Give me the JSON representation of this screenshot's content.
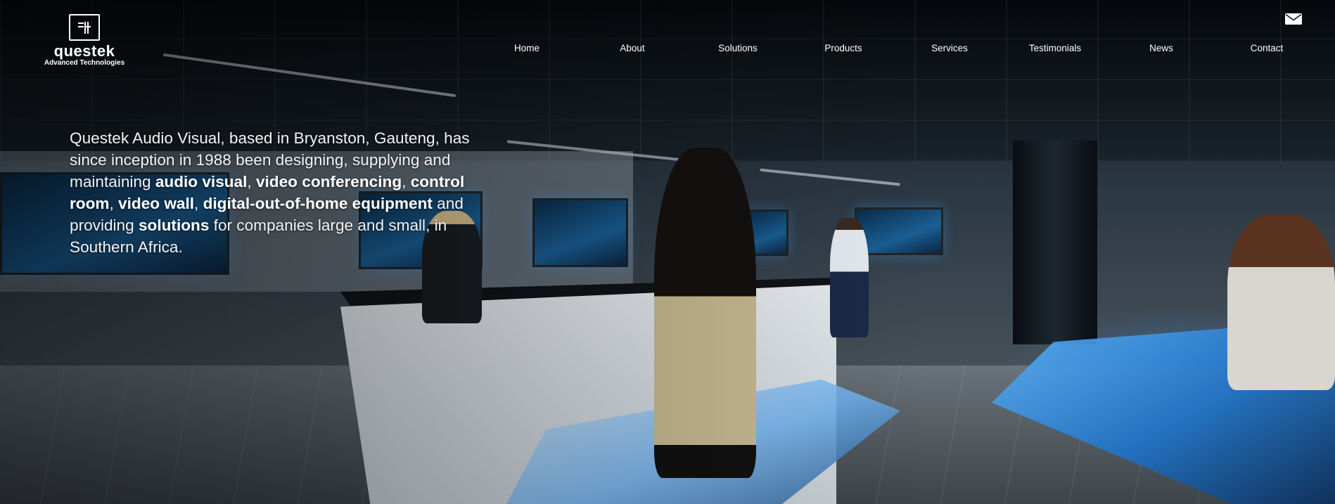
{
  "brand": {
    "name": "questek",
    "tagline": "Advanced Technologies"
  },
  "nav": {
    "items": [
      "Home",
      "About",
      "Solutions",
      "Products",
      "Services",
      "Testimonials",
      "News",
      "Contact"
    ]
  },
  "header_icons": {
    "mail": "mail-icon"
  },
  "hero": {
    "t1": "Questek Audio Visual, based in Bryanston, Gauteng, has since inception in 1988 been designing, supplying and maintaining ",
    "b1": "audio visual",
    "t2": ", ",
    "b2": "video conferencing",
    "t3": ", ",
    "b3": "control room",
    "t4": ", ",
    "b4": "video wall",
    "t5": ", ",
    "b5": "digital-out-of-home equipment",
    "t6": " and providing ",
    "b6": "solutions",
    "t7": " for companies large and small, in Southern Africa."
  },
  "colors": {
    "text": "#ffffff",
    "accent_glow": "#5fb6ff"
  }
}
